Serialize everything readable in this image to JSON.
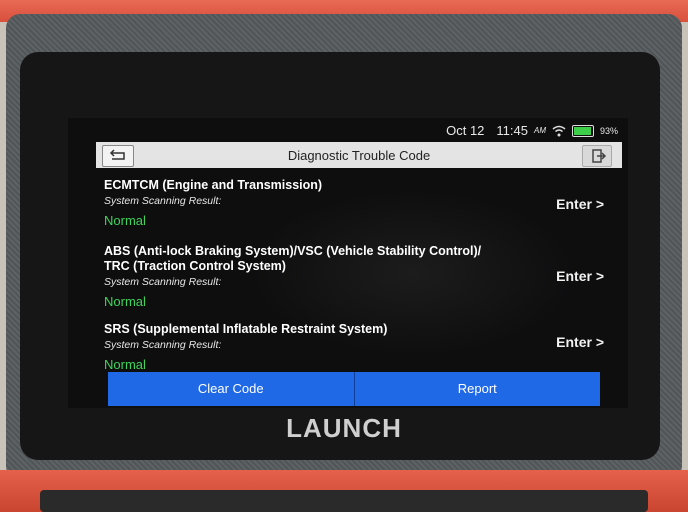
{
  "status": {
    "date": "Oct 12",
    "time": "11:45",
    "ampm": "AM",
    "battery": "93%",
    "battery_level": 0.93
  },
  "header": {
    "title": "Diagnostic Trouble Code"
  },
  "systems": [
    {
      "name": "ECMTCM (Engine and Transmission)",
      "sub": "System Scanning Result:",
      "status": "Normal",
      "action": "Enter >"
    },
    {
      "name": "ABS (Anti-lock Braking System)/VSC (Vehicle Stability Control)/ TRC (Traction Control System)",
      "sub": "System Scanning Result:",
      "status": "Normal",
      "action": "Enter >"
    },
    {
      "name": "SRS (Supplemental Inflatable Restraint System)",
      "sub": "System Scanning Result:",
      "status": "Normal",
      "action": "Enter >"
    }
  ],
  "footer": {
    "clear_label": "Clear Code",
    "report_label": "Report"
  },
  "device": {
    "brand": "LAUNCH"
  },
  "colors": {
    "accent": "#1f68e6",
    "status_ok": "#3fd45a",
    "housing": "#d9503c"
  }
}
